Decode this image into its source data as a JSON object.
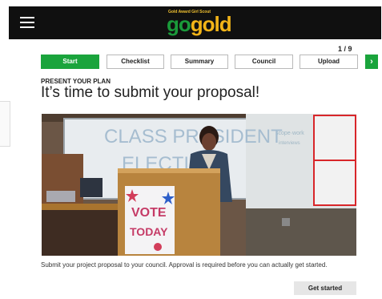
{
  "header": {
    "logo_small": "Gold Award Girl Scout",
    "logo_go": "go",
    "logo_gold": "gold"
  },
  "progress": {
    "counter": "1 / 9"
  },
  "steps": [
    {
      "label": "Start",
      "active": true
    },
    {
      "label": "Checklist",
      "active": false
    },
    {
      "label": "Summary",
      "active": false
    },
    {
      "label": "Council",
      "active": false
    },
    {
      "label": "Upload",
      "active": false
    }
  ],
  "next_icon": "chevron-right-icon",
  "section_label": "PRESENT YOUR PLAN",
  "title": "It’s time to submit your proposal!",
  "photo": {
    "board_text_1": "CLASS PRESIDENT",
    "board_text_2": "ELECTION",
    "poster_line_1": "VOTE",
    "poster_line_2": "TODAY"
  },
  "description": "Submit your project proposal to your council.  Approval is required before you can actually get started.",
  "cta_label": "Get started",
  "colors": {
    "header_bg": "#101010",
    "accent_green": "#1aa43c",
    "logo_gold": "#f2b418",
    "button_gray": "#e6e6e6"
  }
}
